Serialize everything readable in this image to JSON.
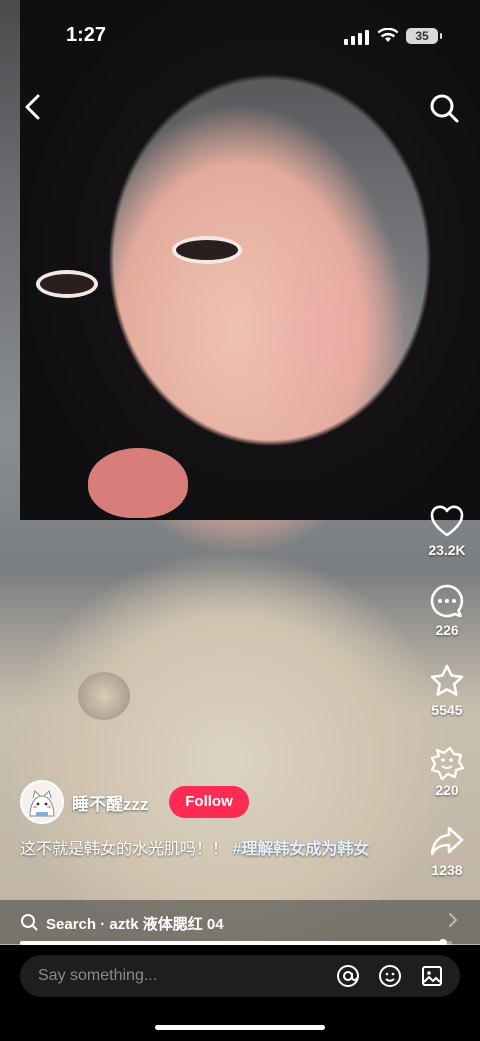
{
  "status_bar": {
    "time": "1:27",
    "battery": "35"
  },
  "top_nav": {
    "back_icon": "chevron-left-icon",
    "search_icon": "search-icon"
  },
  "rail": {
    "likes": "23.2K",
    "comments": "226",
    "favorites": "5545",
    "shares_alt": "220",
    "shares": "1238"
  },
  "author": {
    "username": "睡不醒zzz",
    "follow_label": "Follow"
  },
  "caption": {
    "text": "这不就是韩女的水光肌吗！！ ",
    "hashtag": "#理解韩女成为韩女"
  },
  "search_bar": {
    "label": "Search · aztk 液体腮红 04"
  },
  "progress": {
    "fraction": 0.98
  },
  "comment_bar": {
    "placeholder": "Say something..."
  },
  "colors": {
    "follow": "#fe2c55",
    "accent": "#ffffff"
  }
}
